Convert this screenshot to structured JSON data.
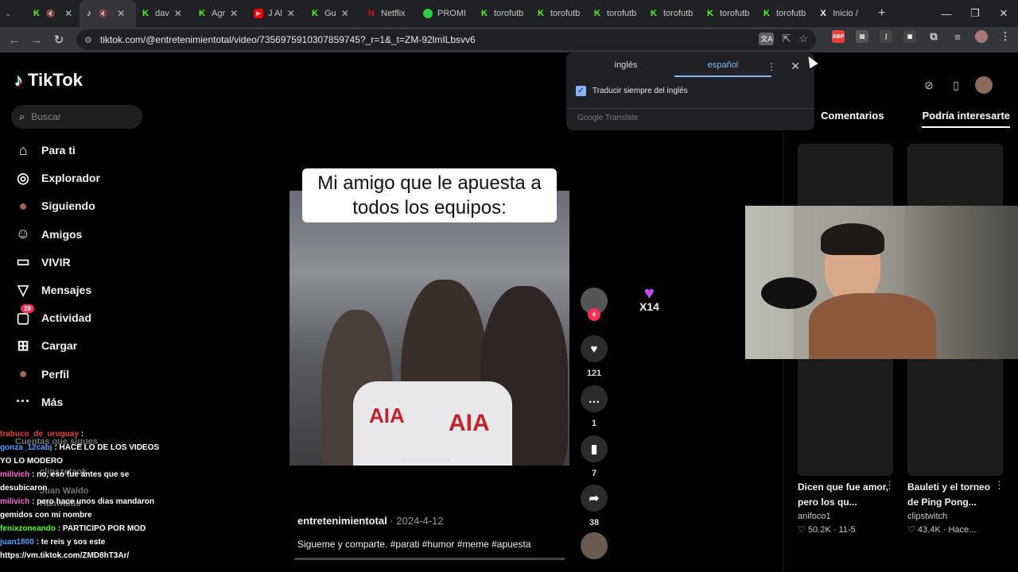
{
  "browser": {
    "tabs": [
      {
        "title": "",
        "favicon": "K",
        "color": "#53fc18"
      },
      {
        "title": "",
        "favicon": "tiktok",
        "color": "#000000",
        "active": true
      },
      {
        "title": "dav",
        "favicon": "K",
        "color": "#53fc18"
      },
      {
        "title": "Agr",
        "favicon": "K",
        "color": "#53fc18"
      },
      {
        "title": "J Al",
        "favicon": "yt",
        "color": "#ff0000"
      },
      {
        "title": "Gu",
        "favicon": "K",
        "color": "#53fc18"
      },
      {
        "title": "Netflix",
        "favicon": "N",
        "color": "#e50914"
      },
      {
        "title": "PROMI",
        "favicon": "o",
        "color": "#2ecc40"
      },
      {
        "title": "torofutb",
        "favicon": "K",
        "color": "#53fc18"
      },
      {
        "title": "torofutb",
        "favicon": "K",
        "color": "#53fc18"
      },
      {
        "title": "torofutb",
        "favicon": "K",
        "color": "#53fc18"
      },
      {
        "title": "torofutb",
        "favicon": "K",
        "color": "#53fc18"
      },
      {
        "title": "torofutb",
        "favicon": "K",
        "color": "#53fc18"
      },
      {
        "title": "torofutb",
        "favicon": "K",
        "color": "#53fc18"
      },
      {
        "title": "Inicio /",
        "favicon": "X",
        "color": "#ffffff"
      }
    ],
    "url": "tiktok.com/@entretenimientotal/video/7356975910307859745?_r=1&_t=ZM-92lmILbsvv6"
  },
  "translate_popup": {
    "lang_source": "inglés",
    "lang_target": "español",
    "always_translate": "Traducir siempre del inglés",
    "footer": "Google Translate"
  },
  "sidebar": {
    "logo": "TikTok",
    "search_placeholder": "Buscar",
    "items": [
      {
        "label": "Para ti",
        "icon": "home-icon"
      },
      {
        "label": "Explorador",
        "icon": "compass-icon"
      },
      {
        "label": "Siguiendo",
        "icon": "avatar-icon"
      },
      {
        "label": "Amigos",
        "icon": "friends-icon"
      },
      {
        "label": "VIVIR",
        "icon": "live-icon"
      },
      {
        "label": "Mensajes",
        "icon": "message-icon"
      },
      {
        "label": "Actividad",
        "icon": "activity-icon",
        "badge": "28"
      },
      {
        "label": "Cargar",
        "icon": "upload-icon"
      },
      {
        "label": "Perfil",
        "icon": "profile-icon"
      },
      {
        "label": "Más",
        "icon": "more-icon"
      }
    ],
    "following_header": "Cuentas que sigues",
    "following": [
      "clipszetaok",
      "Juan Waldo",
      "Hanwaldo"
    ]
  },
  "chat": [
    {
      "user": "trabuco_de_uruguay",
      "msg": "",
      "color": "#e8413c"
    },
    {
      "user": "gonza_12cabj",
      "msg": "HACE LO DE LOS VIDEOS YO LO MODERO",
      "color": "#4aa3ff"
    },
    {
      "user": "milivich",
      "msg": "no, eso fue antes que se desubicaron",
      "color": "#ff6ad5"
    },
    {
      "user": "milivich",
      "msg": "pero hace unos dias mandaron gemidos con mi nombre",
      "color": "#ff6ad5"
    },
    {
      "user": "fenixzoneando",
      "msg": "PARTICIPO POR MOD",
      "color": "#53fc18"
    },
    {
      "user": "juan1800",
      "msg": "te reis y sos este https://vm.tiktok.com/ZMD8hT3Ar/",
      "color": "#4aa3ff"
    }
  ],
  "video": {
    "caption": "Mi amigo que le apuesta a todos los equipos:",
    "watermark": "@entretenimientotal",
    "author": "entretenimientotal",
    "date": "2024-4-12",
    "description": "Sigueme y comparte. #parati #humor #meme #apuesta",
    "likes": "121",
    "comments": "1",
    "saves": "7",
    "shares": "38",
    "overlay_text": "X14"
  },
  "right_panel": {
    "tabs": [
      "Comentarios",
      "Podría interesarte"
    ],
    "active_tab": "Podría interesarte",
    "cards": [
      {
        "title": "Dicen que fue amor, pero los qu...",
        "author": "anifoco1",
        "views": "50.2K",
        "date": "11-5"
      },
      {
        "title": "Bauleti y el torneo de Ping Pong...",
        "author": "clipstwitch",
        "views": "43.4K",
        "date": "Hace..."
      }
    ]
  }
}
